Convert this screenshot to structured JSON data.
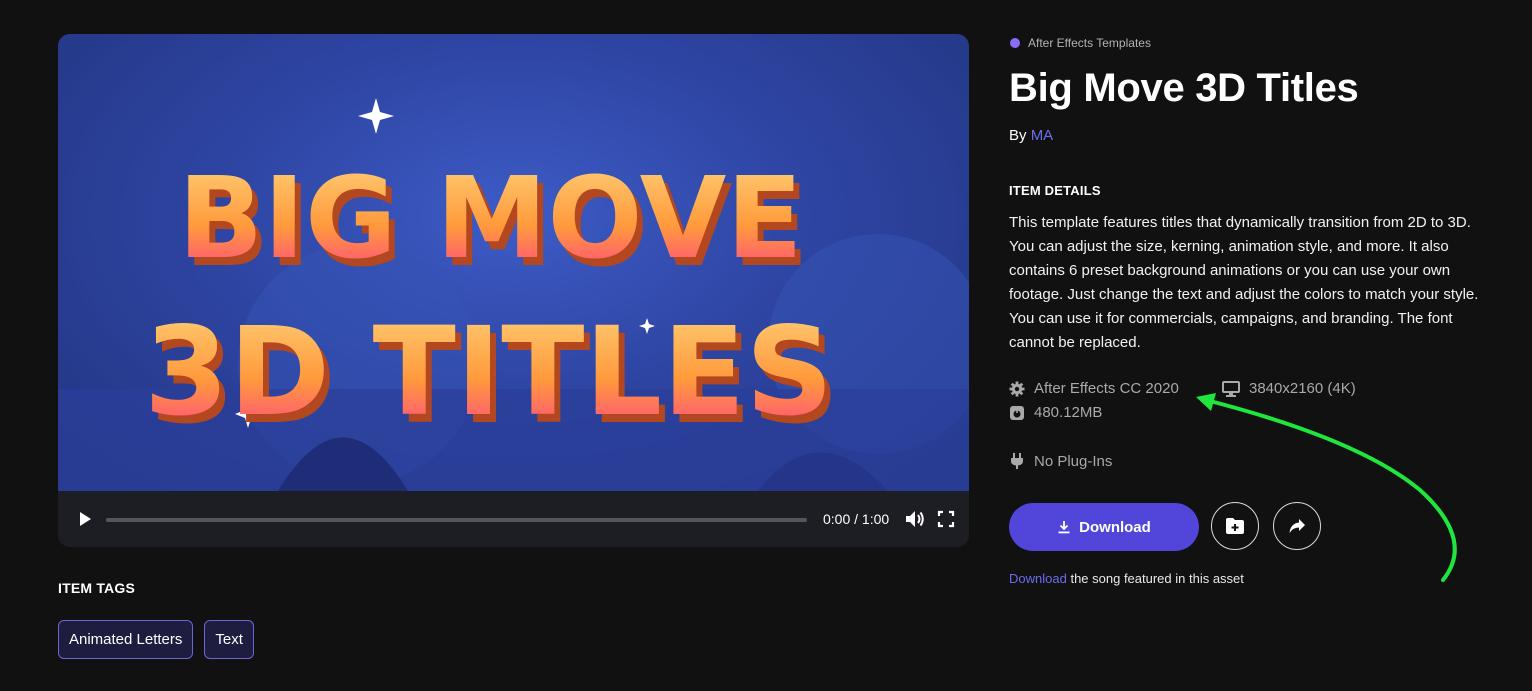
{
  "player": {
    "poster_line1": "BIG MOVE",
    "poster_line2": "3D TITLES",
    "time": "0:00 / 1:00",
    "progress": 0
  },
  "item": {
    "category": "After Effects Templates",
    "title": "Big Move 3D Titles",
    "by_prefix": "By",
    "author": "MA",
    "details_heading": "ITEM DETAILS",
    "description": "This template features titles that dynamically transition from 2D to 3D. You can adjust the size, kerning, animation style, and more. It also contains 6 preset background animations or you can use your own footage. Just change the text and adjust the colors to match your style. You can use it for commercials, campaigns, and branding. The font cannot be replaced.",
    "specs": {
      "software": "After Effects CC 2020",
      "resolution": "3840x2160 (4K)",
      "file_size": "480.12MB",
      "plugins": "No Plug-Ins"
    },
    "download_label": "Download",
    "song_link": "Download",
    "song_text": "the song featured in this asset"
  },
  "tags": {
    "heading": "ITEM TAGS",
    "items": [
      "Animated Letters",
      "Text"
    ]
  },
  "colors": {
    "accent": "#5146d9",
    "link": "#6d6cf0",
    "category_dot": "#8b6cf6",
    "annotation": "#1ee63c"
  },
  "icons": {
    "play": "play-icon",
    "volume": "volume-icon",
    "fullscreen": "fullscreen-icon",
    "software": "gear-icon",
    "resolution": "monitor-icon",
    "file_size": "file-size-icon",
    "plugins": "plug-icon",
    "download": "download-icon",
    "save": "folder-add-icon",
    "share": "share-icon"
  }
}
